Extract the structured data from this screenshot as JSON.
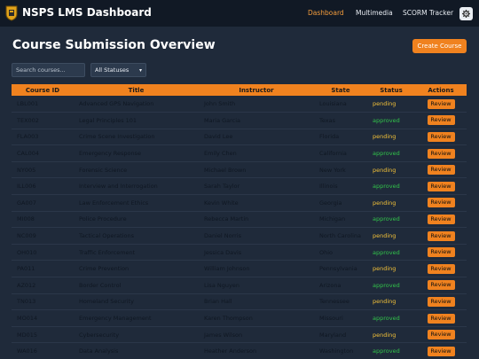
{
  "app": {
    "title": "NSPS LMS Dashboard",
    "nav": [
      {
        "label": "Dashboard",
        "active": true
      },
      {
        "label": "Multimedia",
        "active": false
      },
      {
        "label": "SCORM Tracker",
        "active": false
      }
    ],
    "settings_icon": "gear-icon",
    "logo_icon": "shield-logo-icon"
  },
  "page": {
    "title": "Course Submission Overview",
    "create_label": "Create Course"
  },
  "filters": {
    "search_placeholder": "Search courses...",
    "status_selected": "All Statuses"
  },
  "table": {
    "headers": [
      "Course ID",
      "Title",
      "Instructor",
      "State",
      "Status",
      "Actions"
    ],
    "rows": [
      {
        "id": "LBL001",
        "title": "Advanced GPS Navigation",
        "instructor": "John Smith",
        "state": "Louisiana",
        "status": "pending"
      },
      {
        "id": "TEX002",
        "title": "Legal Principles 101",
        "instructor": "Maria Garcia",
        "state": "Texas",
        "status": "approved"
      },
      {
        "id": "FLA003",
        "title": "Crime Scene Investigation",
        "instructor": "David Lee",
        "state": "Florida",
        "status": "pending"
      },
      {
        "id": "CAL004",
        "title": "Emergency Response",
        "instructor": "Emily Chen",
        "state": "California",
        "status": "approved"
      },
      {
        "id": "NY005",
        "title": "Forensic Science",
        "instructor": "Michael Brown",
        "state": "New York",
        "status": "pending"
      },
      {
        "id": "ILL006",
        "title": "Interview and Interrogation",
        "instructor": "Sarah Taylor",
        "state": "Illinois",
        "status": "approved"
      },
      {
        "id": "GA007",
        "title": "Law Enforcement Ethics",
        "instructor": "Kevin White",
        "state": "Georgia",
        "status": "pending"
      },
      {
        "id": "MI008",
        "title": "Police Procedure",
        "instructor": "Rebecca Martin",
        "state": "Michigan",
        "status": "approved"
      },
      {
        "id": "NC009",
        "title": "Tactical Operations",
        "instructor": "Daniel Norris",
        "state": "North Carolina",
        "status": "pending"
      },
      {
        "id": "OH010",
        "title": "Traffic Enforcement",
        "instructor": "Jessica Davis",
        "state": "Ohio",
        "status": "approved"
      },
      {
        "id": "PA011",
        "title": "Crime Prevention",
        "instructor": "William Johnson",
        "state": "Pennsylvania",
        "status": "pending"
      },
      {
        "id": "AZ012",
        "title": "Border Control",
        "instructor": "Lisa Nguyen",
        "state": "Arizona",
        "status": "approved"
      },
      {
        "id": "TN013",
        "title": "Homeland Security",
        "instructor": "Brian Hall",
        "state": "Tennessee",
        "status": "pending"
      },
      {
        "id": "MO014",
        "title": "Emergency Management",
        "instructor": "Karen Thompson",
        "state": "Missouri",
        "status": "approved"
      },
      {
        "id": "MD015",
        "title": "Cybersecurity",
        "instructor": "James Wilson",
        "state": "Maryland",
        "status": "pending"
      },
      {
        "id": "WA016",
        "title": "Data Analysis",
        "instructor": "Heather Anderson",
        "state": "Washington",
        "status": "approved"
      }
    ],
    "action_label": "Review"
  },
  "colors": {
    "accent": "#f0821f",
    "background": "#1f2a3a",
    "topbar": "#111925",
    "pending": "#f2c038",
    "approved": "#32c24a"
  }
}
